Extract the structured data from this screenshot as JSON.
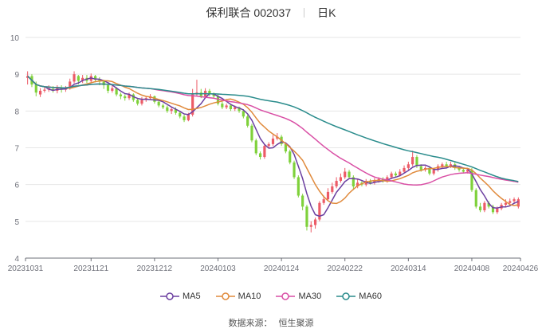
{
  "header": {
    "stock": "保利联合 002037",
    "period": "日K"
  },
  "source": {
    "label": "数据来源：",
    "name": "恒生聚源"
  },
  "colors": {
    "up": "#ec5b67",
    "down": "#7fd13b",
    "grid": "#e6e6e6",
    "axis": "#6e7079"
  },
  "chart_data": {
    "type": "candlestick",
    "ylim": [
      4,
      10
    ],
    "yticks": [
      4,
      5,
      6,
      7,
      8,
      9,
      10
    ],
    "x_tick_labels": [
      "20231031",
      "20231121",
      "20231212",
      "20240103",
      "20240124",
      "20240222",
      "20240314",
      "20240408",
      "20240426"
    ],
    "x_tick_positions": [
      0,
      15,
      30,
      45,
      60,
      75,
      90,
      105,
      116
    ],
    "grid": true,
    "legend_position": "bottom-center",
    "candles": [
      [
        8.9,
        8.95,
        9.08,
        8.72
      ],
      [
        8.95,
        8.72,
        9.0,
        8.65
      ],
      [
        8.72,
        8.5,
        8.8,
        8.4
      ],
      [
        8.45,
        8.55,
        8.62,
        8.38
      ],
      [
        8.55,
        8.58,
        8.66,
        8.5
      ],
      [
        8.58,
        8.62,
        8.7,
        8.52
      ],
      [
        8.6,
        8.55,
        8.68,
        8.5
      ],
      [
        8.55,
        8.63,
        8.7,
        8.48
      ],
      [
        8.63,
        8.58,
        8.7,
        8.5
      ],
      [
        8.58,
        8.62,
        8.68,
        8.52
      ],
      [
        8.62,
        8.8,
        8.88,
        8.58
      ],
      [
        8.8,
        9.0,
        9.08,
        8.75
      ],
      [
        8.95,
        8.82,
        8.98,
        8.72
      ],
      [
        8.82,
        8.9,
        8.98,
        8.76
      ],
      [
        8.9,
        8.82,
        8.98,
        8.76
      ],
      [
        8.82,
        8.95,
        9.02,
        8.78
      ],
      [
        8.95,
        8.85,
        8.98,
        8.78
      ],
      [
        8.85,
        8.8,
        8.92,
        8.7
      ],
      [
        8.8,
        8.7,
        8.85,
        8.6
      ],
      [
        8.7,
        8.55,
        8.75,
        8.48
      ],
      [
        8.55,
        8.62,
        8.7,
        8.5
      ],
      [
        8.62,
        8.45,
        8.65,
        8.4
      ],
      [
        8.45,
        8.4,
        8.5,
        8.32
      ],
      [
        8.4,
        8.35,
        8.45,
        8.28
      ],
      [
        8.35,
        8.45,
        8.5,
        8.3
      ],
      [
        8.45,
        8.3,
        8.48,
        8.25
      ],
      [
        8.3,
        8.2,
        8.35,
        8.15
      ],
      [
        8.2,
        8.3,
        8.38,
        8.15
      ],
      [
        8.3,
        8.35,
        8.4,
        8.25
      ],
      [
        8.35,
        8.4,
        8.46,
        8.3
      ],
      [
        8.4,
        8.25,
        8.42,
        8.2
      ],
      [
        8.25,
        8.15,
        8.3,
        8.1
      ],
      [
        8.15,
        8.1,
        8.2,
        8.05
      ],
      [
        8.1,
        8.0,
        8.15,
        7.95
      ],
      [
        8.0,
        8.05,
        8.1,
        7.92
      ],
      [
        8.05,
        7.95,
        8.1,
        7.9
      ],
      [
        7.95,
        7.85,
        8.0,
        7.8
      ],
      [
        7.85,
        7.75,
        7.9,
        7.7
      ],
      [
        7.75,
        7.9,
        7.95,
        7.72
      ],
      [
        7.9,
        8.45,
        8.6,
        7.85
      ],
      [
        8.45,
        8.5,
        8.85,
        8.4
      ],
      [
        8.5,
        8.4,
        8.6,
        8.35
      ],
      [
        8.4,
        8.55,
        8.62,
        8.35
      ],
      [
        8.55,
        8.45,
        8.6,
        8.4
      ],
      [
        8.45,
        8.4,
        8.5,
        8.35
      ],
      [
        8.4,
        8.2,
        8.45,
        8.15
      ],
      [
        8.2,
        8.1,
        8.25,
        8.05
      ],
      [
        8.1,
        8.15,
        8.2,
        8.05
      ],
      [
        8.15,
        8.05,
        8.18,
        8.0
      ],
      [
        8.05,
        8.1,
        8.15,
        8.0
      ],
      [
        8.1,
        8.0,
        8.12,
        7.95
      ],
      [
        8.0,
        7.85,
        8.05,
        7.8
      ],
      [
        7.85,
        7.6,
        7.9,
        7.55
      ],
      [
        7.6,
        7.2,
        7.65,
        7.15
      ],
      [
        7.2,
        6.85,
        7.25,
        6.8
      ],
      [
        6.85,
        6.75,
        6.9,
        6.68
      ],
      [
        6.75,
        7.05,
        7.1,
        6.7
      ],
      [
        7.05,
        7.1,
        7.15,
        7.0
      ],
      [
        7.1,
        7.25,
        7.35,
        7.05
      ],
      [
        7.25,
        7.3,
        7.4,
        7.2
      ],
      [
        7.3,
        7.1,
        7.35,
        7.05
      ],
      [
        7.1,
        6.9,
        7.15,
        6.85
      ],
      [
        6.9,
        6.6,
        6.95,
        6.55
      ],
      [
        6.6,
        6.2,
        6.65,
        6.15
      ],
      [
        6.2,
        5.7,
        6.25,
        5.65
      ],
      [
        5.7,
        5.4,
        5.75,
        5.3
      ],
      [
        5.4,
        4.85,
        5.45,
        4.75
      ],
      [
        4.85,
        4.9,
        5.0,
        4.7
      ],
      [
        4.9,
        5.05,
        5.1,
        4.8
      ],
      [
        5.05,
        5.5,
        5.55,
        5.0
      ],
      [
        5.5,
        5.6,
        5.7,
        5.45
      ],
      [
        5.6,
        5.8,
        5.9,
        5.55
      ],
      [
        5.8,
        5.95,
        6.05,
        5.75
      ],
      [
        5.95,
        6.1,
        6.2,
        5.9
      ],
      [
        6.1,
        6.2,
        6.3,
        6.05
      ],
      [
        6.2,
        6.35,
        6.45,
        6.15
      ],
      [
        6.35,
        6.2,
        6.4,
        6.15
      ],
      [
        6.2,
        5.95,
        6.25,
        5.85
      ],
      [
        5.95,
        6.05,
        6.15,
        5.9
      ],
      [
        6.05,
        6.0,
        6.1,
        5.95
      ],
      [
        6.0,
        6.1,
        6.15,
        5.95
      ],
      [
        6.1,
        6.05,
        6.15,
        6.0
      ],
      [
        6.05,
        6.1,
        6.18,
        6.0
      ],
      [
        6.1,
        6.15,
        6.2,
        6.05
      ],
      [
        6.15,
        6.1,
        6.2,
        6.05
      ],
      [
        6.1,
        6.2,
        6.25,
        6.05
      ],
      [
        6.2,
        6.3,
        6.35,
        6.15
      ],
      [
        6.3,
        6.25,
        6.35,
        6.2
      ],
      [
        6.25,
        6.35,
        6.42,
        6.22
      ],
      [
        6.35,
        6.45,
        6.52,
        6.3
      ],
      [
        6.45,
        6.55,
        6.62,
        6.4
      ],
      [
        6.55,
        6.75,
        6.92,
        6.5
      ],
      [
        6.75,
        6.5,
        6.8,
        6.45
      ],
      [
        6.5,
        6.4,
        6.55,
        6.35
      ],
      [
        6.4,
        6.45,
        6.5,
        6.35
      ],
      [
        6.45,
        6.3,
        6.5,
        6.25
      ],
      [
        6.3,
        6.4,
        6.45,
        6.25
      ],
      [
        6.4,
        6.5,
        6.55,
        6.35
      ],
      [
        6.5,
        6.55,
        6.6,
        6.45
      ],
      [
        6.55,
        6.5,
        6.62,
        6.45
      ],
      [
        6.5,
        6.55,
        6.62,
        6.45
      ],
      [
        6.55,
        6.45,
        6.6,
        6.4
      ],
      [
        6.45,
        6.4,
        6.5,
        6.35
      ],
      [
        6.4,
        6.35,
        6.45,
        6.3
      ],
      [
        6.35,
        6.4,
        6.45,
        6.3
      ],
      [
        6.4,
        5.85,
        6.45,
        5.8
      ],
      [
        5.85,
        5.4,
        5.9,
        5.35
      ],
      [
        5.4,
        5.3,
        5.5,
        5.25
      ],
      [
        5.3,
        5.5,
        5.55,
        5.25
      ],
      [
        5.5,
        5.4,
        5.55,
        5.35
      ],
      [
        5.4,
        5.25,
        5.45,
        5.2
      ],
      [
        5.25,
        5.35,
        5.4,
        5.2
      ],
      [
        5.35,
        5.45,
        5.5,
        5.3
      ],
      [
        5.45,
        5.5,
        5.6,
        5.4
      ],
      [
        5.5,
        5.55,
        5.62,
        5.45
      ],
      [
        5.55,
        5.6,
        5.65,
        5.5
      ],
      [
        5.4,
        5.6,
        5.65,
        5.35
      ]
    ],
    "series": [
      {
        "name": "MA5",
        "color": "#6b3fa0",
        "window": 5
      },
      {
        "name": "MA10",
        "color": "#e08a3c",
        "window": 10
      },
      {
        "name": "MA30",
        "color": "#d94fa5",
        "window": 30
      },
      {
        "name": "MA60",
        "color": "#2a8c8c",
        "window": 60
      }
    ]
  }
}
